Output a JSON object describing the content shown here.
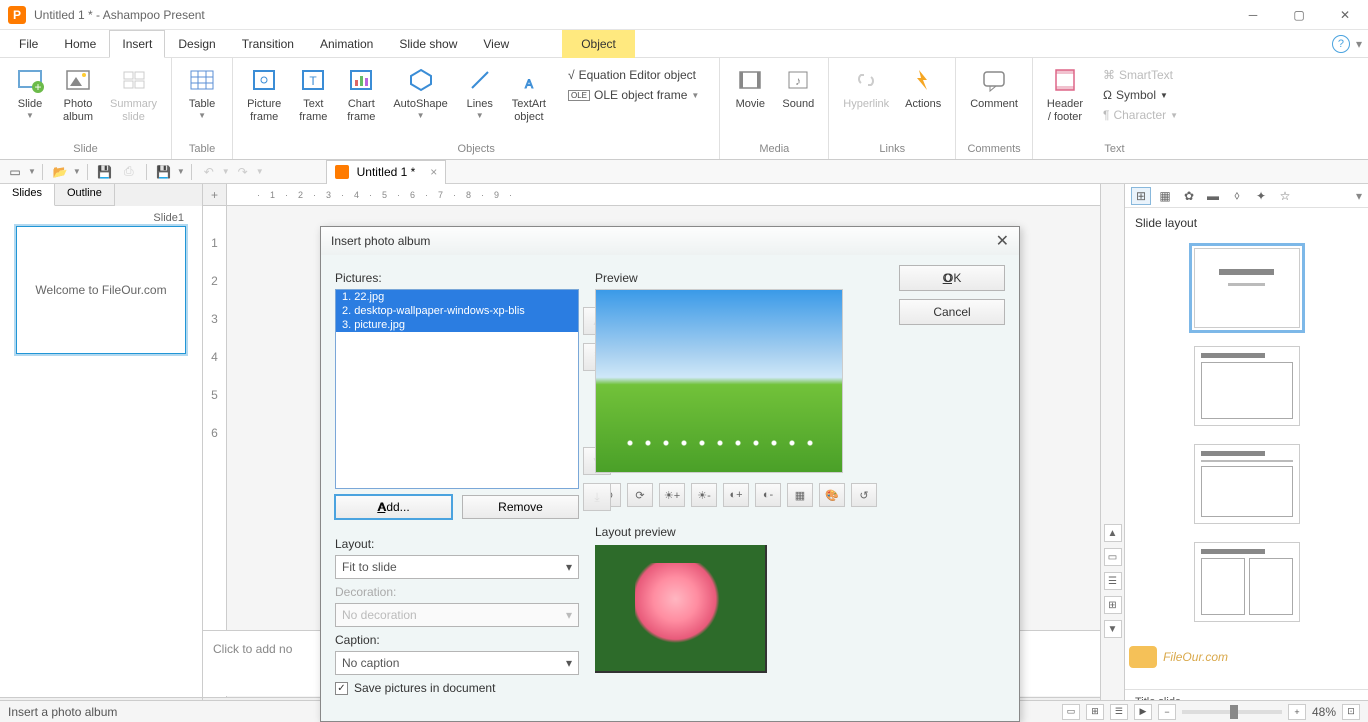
{
  "title": "Untitled 1 * - Ashampoo Present",
  "menus": [
    "File",
    "Home",
    "Insert",
    "Design",
    "Transition",
    "Animation",
    "Slide show",
    "View"
  ],
  "menu_highlight": "Object",
  "ribbon": {
    "slide": {
      "title": "Slide",
      "items": [
        "Slide",
        "Photo\nalbum",
        "Summary\nslide"
      ]
    },
    "table": {
      "title": "Table",
      "items": [
        "Table"
      ]
    },
    "objects": {
      "title": "Objects",
      "items": [
        "Picture\nframe",
        "Text\nframe",
        "Chart\nframe",
        "AutoShape",
        "Lines",
        "TextArt\nobject"
      ],
      "small": [
        {
          "l": "Equation Editor object"
        },
        {
          "l": "OLE object frame"
        }
      ]
    },
    "media": {
      "title": "Media",
      "items": [
        "Movie",
        "Sound"
      ]
    },
    "links": {
      "title": "Links",
      "items": [
        "Hyperlink",
        "Actions"
      ]
    },
    "comments": {
      "title": "Comments",
      "items": [
        "Comment"
      ]
    },
    "text": {
      "title": "Text",
      "items": [
        "Header\n/ footer"
      ],
      "small": [
        "SmartText",
        "Symbol",
        "Character"
      ]
    }
  },
  "doc_tab": "Untitled 1 *",
  "left_tabs": [
    "Slides",
    "Outline"
  ],
  "slide1_label": "Slide1",
  "slide1_text": "Welcome to FileOur.com",
  "notes_placeholder": "Click to add no",
  "right": {
    "title": "Slide layout",
    "footer": "Title slide"
  },
  "status": {
    "left": "Insert a photo album",
    "zoom": "48%"
  },
  "dialog": {
    "title": "Insert photo album",
    "pictures_lbl": "Pictures:",
    "preview_lbl": "Preview",
    "files": [
      "1. 22.jpg",
      "2. desktop-wallpaper-windows-xp-blis",
      "3. picture.jpg"
    ],
    "add": "Add...",
    "remove": "Remove",
    "layout_lbl": "Layout:",
    "layout_val": "Fit to slide",
    "decoration_lbl": "Decoration:",
    "decoration_val": "No decoration",
    "caption_lbl": "Caption:",
    "caption_val": "No caption",
    "layoutprev_lbl": "Layout preview",
    "save_cb": "Save pictures in document",
    "ok": "OK",
    "cancel": "Cancel"
  },
  "watermark": "FileOur.com"
}
